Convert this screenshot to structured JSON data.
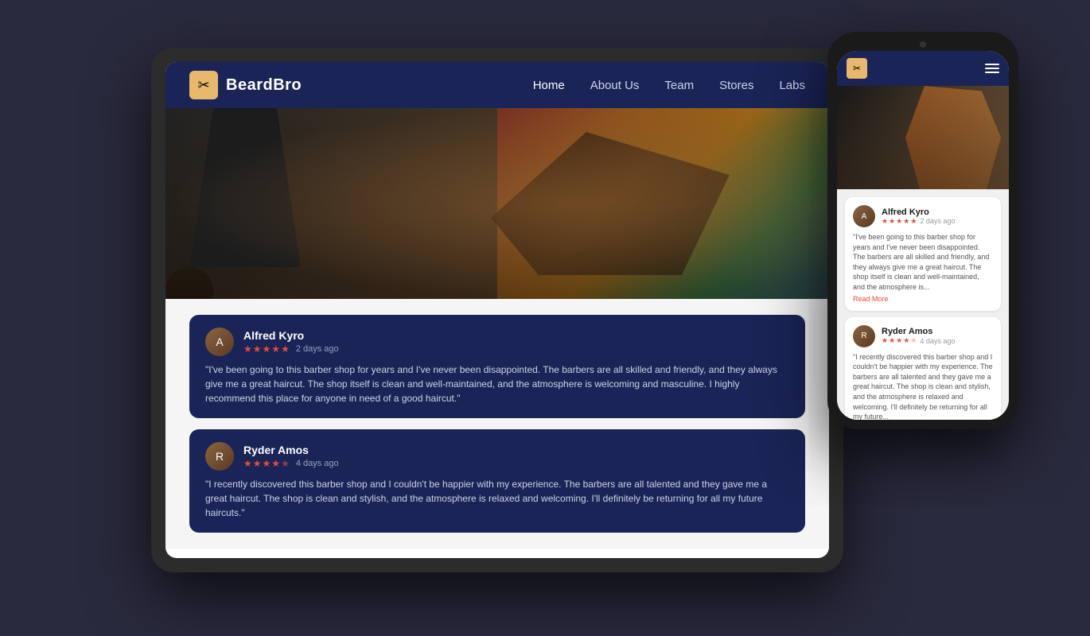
{
  "brand": {
    "name": "BeardBro",
    "icon": "✂"
  },
  "nav": {
    "links": [
      {
        "label": "Home",
        "active": true
      },
      {
        "label": "About Us",
        "active": false
      },
      {
        "label": "Team",
        "active": false
      },
      {
        "label": "Stores",
        "active": false
      },
      {
        "label": "Labs",
        "active": false
      }
    ]
  },
  "reviews": [
    {
      "name": "Alfred Kyro",
      "date": "2 days ago",
      "stars": 5,
      "text": "\"I've been going to this barber shop for years and I've never been disappointed. The barbers are all skilled and friendly, and they always give me a great haircut. The shop itself is clean and well-maintained, and the atmosphere is welcoming and masculine. I highly recommend this place for anyone in need of a good haircut.\""
    },
    {
      "name": "Ryder Amos",
      "date": "4 days ago",
      "stars": 4,
      "text": "\"I recently discovered this barber shop and I couldn't be happier with my experience. The barbers are all talented and they gave me a great haircut. The shop is clean and stylish, and the atmosphere is relaxed and welcoming. I'll definitely be returning for all my future haircuts.\""
    }
  ],
  "phone_reviews": [
    {
      "name": "Alfred Kyro",
      "date": "2 days ago",
      "stars": 5,
      "text": "\"I've been going to this barber shop for years and I've never been disappointed. The barbers are all skilled and friendly, and they always give me a great haircut. The shop itself is clean and well-maintained, and the atmosphere is...",
      "read_more": "Read More"
    },
    {
      "name": "Ryder Amos",
      "date": "4 days ago",
      "stars": 4,
      "text": "\"I recently discovered this barber shop and I couldn't be happier with my experience. The barbers are all talented and they gave me a great haircut. The shop is clean and stylish, and the atmosphere is relaxed and welcoming. I'll definitely be returning for all my future..."
    }
  ]
}
